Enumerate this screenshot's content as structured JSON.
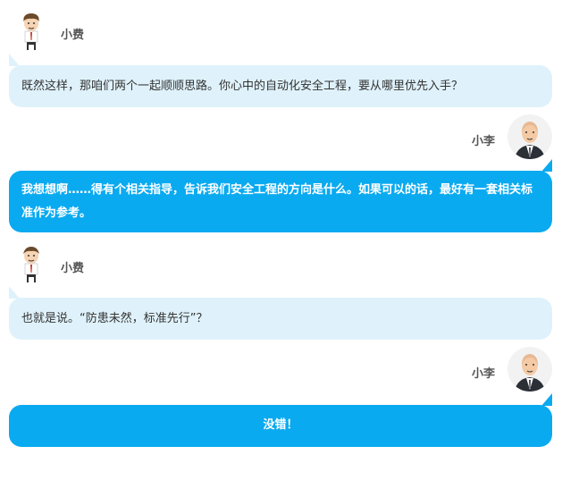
{
  "colors": {
    "left_bubble": "#dff2fb",
    "right_bubble": "#0aaaf0",
    "name": "#555555"
  },
  "messages": [
    {
      "sender": "小费",
      "side": "left",
      "avatar": "cartoon-man-icon",
      "text": "既然这样，那咱们两个一起顺顺思路。你心中的自动化安全工程，要从哪里优先入手？"
    },
    {
      "sender": "小李",
      "side": "right",
      "avatar": "bald-man-avatar",
      "text": "我想想啊……得有个相关指导，告诉我们安全工程的方向是什么。如果可以的话，最好有一套相关标准作为参考。"
    },
    {
      "sender": "小费",
      "side": "left",
      "avatar": "cartoon-man-icon",
      "text": "也就是说。“防患未然，标准先行”？"
    },
    {
      "sender": "小李",
      "side": "right",
      "avatar": "bald-man-avatar",
      "text": "没错！"
    }
  ]
}
